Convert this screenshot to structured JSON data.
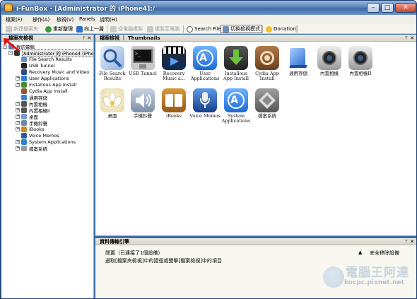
{
  "window": {
    "title": "i-FunBox - [Administrator 的 iPhone4]:/",
    "controls": {
      "minimize": "–",
      "maximize": "□",
      "close": "✕"
    }
  },
  "menu": [
    "檔案(F)",
    "操作(A)",
    "檢視(V)",
    "Panels",
    "說明(H)"
  ],
  "toolbar": {
    "items": [
      {
        "label": "新建檔案夾",
        "icon": "new-folder-icon",
        "disabled": true
      },
      {
        "label": "重新整理",
        "icon": "refresh-icon",
        "disabled": false
      },
      {
        "label": "向上一層",
        "icon": "up-arrow-icon",
        "disabled": false
      },
      {
        "label": "從電腦複製",
        "icon": "copy-from-pc-icon",
        "disabled": true
      },
      {
        "label": "複製至電腦",
        "icon": "copy-to-pc-icon",
        "disabled": true
      },
      {
        "label": "Search Files",
        "icon": "search-icon",
        "disabled": false
      },
      {
        "label": "切換檢視模式",
        "icon": "view-mode-icon",
        "disabled": false,
        "pressed": true
      },
      {
        "label": "Donation",
        "icon": "donation-icon",
        "disabled": false
      }
    ]
  },
  "left_panel": {
    "title": "檔案夾檢視",
    "pin": "ᛘ",
    "close": "✕",
    "tree": [
      {
        "label": "我的電腦",
        "level": 0,
        "expander": "-",
        "icon": "computer-icon"
      },
      {
        "label": "Administrator 的 iPhone4 (iPhone",
        "level": 1,
        "expander": "-",
        "icon": "iphone-icon",
        "selected": true
      },
      {
        "label": "File Search Results",
        "level": 2,
        "expander": "",
        "icon": "search-results-icon"
      },
      {
        "label": "USB Tunnel",
        "level": 2,
        "expander": "",
        "icon": "usb-tunnel-icon"
      },
      {
        "label": "Recovery Music and Video",
        "level": 2,
        "expander": "",
        "icon": "recovery-icon"
      },
      {
        "label": "User Applications",
        "level": 2,
        "expander": "+",
        "icon": "app-store-icon"
      },
      {
        "label": "Installous App Install",
        "level": 2,
        "expander": "+",
        "icon": "installous-icon"
      },
      {
        "label": "Cydia App Install",
        "level": 2,
        "expander": "",
        "icon": "cydia-icon"
      },
      {
        "label": "通用存儲",
        "level": 2,
        "expander": "",
        "icon": "storage-icon"
      },
      {
        "label": "內置相機",
        "level": 2,
        "expander": "+",
        "icon": "camera-icon"
      },
      {
        "label": "內置相機II",
        "level": 2,
        "expander": "+",
        "icon": "camera-icon"
      },
      {
        "label": "桌面",
        "level": 2,
        "expander": "+",
        "icon": "desktop-icon"
      },
      {
        "label": "手機鈴聲",
        "level": 2,
        "expander": "+",
        "icon": "ringtone-icon"
      },
      {
        "label": "iBooks",
        "level": 2,
        "expander": "+",
        "icon": "ibooks-icon"
      },
      {
        "label": "Voice Memos",
        "level": 2,
        "expander": "",
        "icon": "voice-memos-icon"
      },
      {
        "label": "System Applications",
        "level": 2,
        "expander": "+",
        "icon": "app-store-icon"
      },
      {
        "label": "檔案系統",
        "level": 2,
        "expander": "+",
        "icon": "filesystem-icon"
      }
    ]
  },
  "thumbnails_panel": {
    "title": "檔案檢視 ｜ Thumbnails",
    "pin": "ᛘ",
    "close": "✕",
    "items": [
      {
        "label": "File Search Results",
        "icon": "search-results-icon"
      },
      {
        "label": "USB Tunnel",
        "icon": "usb-tunnel-icon"
      },
      {
        "label": "Recovery Music a...",
        "icon": "recovery-icon"
      },
      {
        "label": "User Applications",
        "icon": "app-store-icon"
      },
      {
        "label": "Installous App Install",
        "icon": "installous-icon"
      },
      {
        "label": "Cydia App Install",
        "icon": "cydia-icon"
      },
      {
        "label": "通用存儲",
        "icon": "storage-icon"
      },
      {
        "label": "內置相機",
        "icon": "camera-icon"
      },
      {
        "label": "內置相機II",
        "icon": "camera-icon"
      },
      {
        "label": "桌面",
        "icon": "lotus-icon"
      },
      {
        "label": "手機鈴聲",
        "icon": "speaker-icon"
      },
      {
        "label": "iBooks",
        "icon": "ibooks-icon"
      },
      {
        "label": "Voice Memos",
        "icon": "microphone-icon"
      },
      {
        "label": "System Applications",
        "icon": "app-store-icon"
      },
      {
        "label": "檔案系統",
        "icon": "filesystem-icon"
      }
    ]
  },
  "status_panel": {
    "title": "資料傳輸引擎",
    "pin": "ᛘ",
    "close": "✕",
    "line1": "閒置（已連接了1個設備）",
    "line2": "選取[檔案夾檢視]中的捷徑或雙擊[檔案檢視]中的項目",
    "warning_icon": "▲",
    "safe_remove": "安全移除設備"
  },
  "watermark": {
    "text": "電腦王阿達",
    "url": "kocpc.pixnet.net"
  },
  "colors": {
    "titlebar": "#5c86bd",
    "window_border": "#1d3f74",
    "panel_header": "#d8d6cc",
    "app_store_blue": "#2f7fd6"
  }
}
